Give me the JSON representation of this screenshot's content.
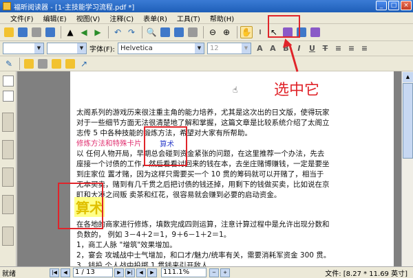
{
  "window": {
    "title": "福昕阅读器 - [1-主技能学习流程.pdf *]",
    "buttons": [
      "_",
      "□",
      "×"
    ]
  },
  "menu": [
    "文件(F)",
    "编辑(E)",
    "视图(V)",
    "注释(C)",
    "表单(R)",
    "工具(T)",
    "帮助(H)"
  ],
  "toolbar2": {
    "font_label": "字体(F):",
    "font_value": "Helvetica",
    "size_value": "12"
  },
  "page": {
    "lines": [
      "太阁系列的游戏历来很注重主角的能力培养，尤其是这次出的日文版，使得玩家",
      "对于一些细节方面无法很清楚地了解和掌握，这篇文章是比较系统介绍了太阁立",
      "志传 5 中各种技能的锻炼方法，希望对大家有所帮助。",
      "以  任何人物开局，早期总会碰到资金紧张的问题，在这里推荐一个办法，先去",
      "座接一个讨债的工作，然后看看讨回来的钱在本，去坐庄赌博赚钱，一定是要坐",
      "到庄家位  置才赌，因为这样只需要买一个 10 贯的筹码就可以开赌了，相当于",
      "无本买卖，赌到有几千贯之后把讨债的钱还掉，用剩下的钱做买卖，比如说在京",
      "町和大凑之间贩  卖茶和红花，很容易就会赚到必要的启动资金。",
      "在各地的商家进行修炼，填数完成四则运算，注意计算过程中是允许出现分数和",
      "负数的，  例如 3－4＋2＝1，9＋6－1＋2＝1。",
      "1，商工人脉  \"增筑\"效果增加。",
      "2，宴会  攻城战中士气增加，和口才/魅力/统率有关，需要消耗军资金 300 贯。",
      "3，钱投  个人战中投掷 1 贯钱来引开敌人。"
    ],
    "section_heading": "修炼方法和特殊卡片",
    "section_sub": "算术",
    "big_title": "算术"
  },
  "annotation": {
    "label": "选中它"
  },
  "status": {
    "ready": "就绪",
    "page": "1 / 13",
    "zoom": "111.1%",
    "size": "文件: [8.27 * 11.69 英寸]"
  }
}
